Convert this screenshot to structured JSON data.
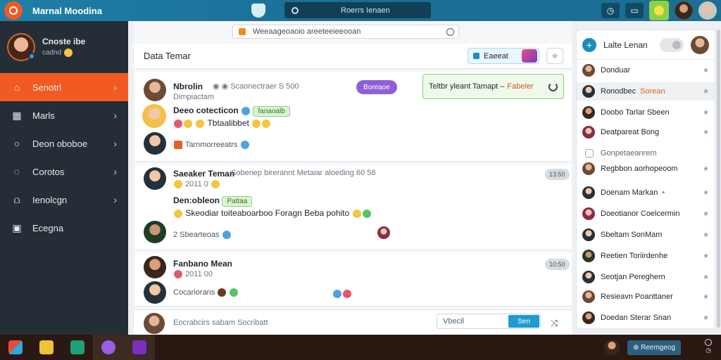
{
  "app": {
    "title": "Marnal Moodina"
  },
  "topbar": {
    "search_text": "Roerrs Ienaen"
  },
  "sidebar": {
    "profile": {
      "name": "Cnoste ibe",
      "status": "cadnd"
    },
    "items": [
      {
        "label": "Senotrl",
        "icon": "home-icon"
      },
      {
        "label": "Marls",
        "icon": "grid-icon"
      },
      {
        "label": "Deon oboboe",
        "icon": "circle-icon"
      },
      {
        "label": "Corotos",
        "icon": "contacts-icon"
      },
      {
        "label": "Ienolcgn",
        "icon": "chart-icon"
      },
      {
        "label": "Ecegna",
        "icon": "calendar-icon"
      }
    ]
  },
  "main": {
    "search_placeholder": "Weeaageoaoio areeteeieeooan",
    "title": "Data Temar",
    "pill_label": "Eaeeat",
    "notification": {
      "text": "Teltbr yleant Tamapt –",
      "highlight": "Fabeler"
    },
    "messages": [
      {
        "name": "Nbrolin",
        "meta": "Scaonectraer S 500",
        "sub": "Dimpiactam",
        "badge": "Boreaoe",
        "line1": "Deeo cotecticon",
        "line1_tag": "fanaoalb",
        "line2": "Tbtaalibbet",
        "line3": "Tarnmorreeatrs"
      },
      {
        "name": "Saeaker Teman",
        "meta": "Sobenep birerannt Metaiar aloeding 60 58",
        "date": "2011 0",
        "badge": "13:50",
        "line1": "Den:obleon",
        "line1_tag": "Pattaa",
        "line2": "Skeodiar toiteaboarboo Foragn Beba pohito",
        "line3": "2 Sbearteoas"
      },
      {
        "name": "Fanbano Mean",
        "date": "2011 00",
        "badge": "10:50",
        "line3": "Cocariorans"
      }
    ],
    "composer": {
      "placeholder": "Eocrabcirs sabam Socribatt",
      "input": "Vbecil",
      "send": "Sen"
    }
  },
  "rpanel": {
    "title": "Lalte Lenan",
    "contacts": [
      {
        "name": "Donduar",
        "star": true
      },
      {
        "name": "Ronodbec",
        "tag": "Sorean",
        "selected": true,
        "star": true
      },
      {
        "name": "Doobo Tarlar Sbeen",
        "star": true
      },
      {
        "name": "Deatpareat Bong",
        "star": true
      },
      {
        "name": "Gonpetaeanrem",
        "muted": true,
        "star": false
      },
      {
        "name": "Regbbon aorhopeoom",
        "star": true
      },
      {
        "name": "Doenam Markan",
        "tag": "•",
        "star": true
      },
      {
        "name": "Doeotianor Coelcermin",
        "star": true
      },
      {
        "name": "Sbeltam SonMam",
        "star": true
      },
      {
        "name": "Reetien Toriirdenhe",
        "star": true
      },
      {
        "name": "Seotjan Pereghern",
        "star": true
      },
      {
        "name": "Resieavn Poanttaner",
        "star": true
      },
      {
        "name": "Doedan Sterar Snan",
        "star": true
      }
    ]
  },
  "taskbar": {
    "button": "Reemgeog"
  },
  "colors": {
    "accent": "#f15a22",
    "topbar": "#1e7fa8",
    "sidebar": "#252d36"
  }
}
